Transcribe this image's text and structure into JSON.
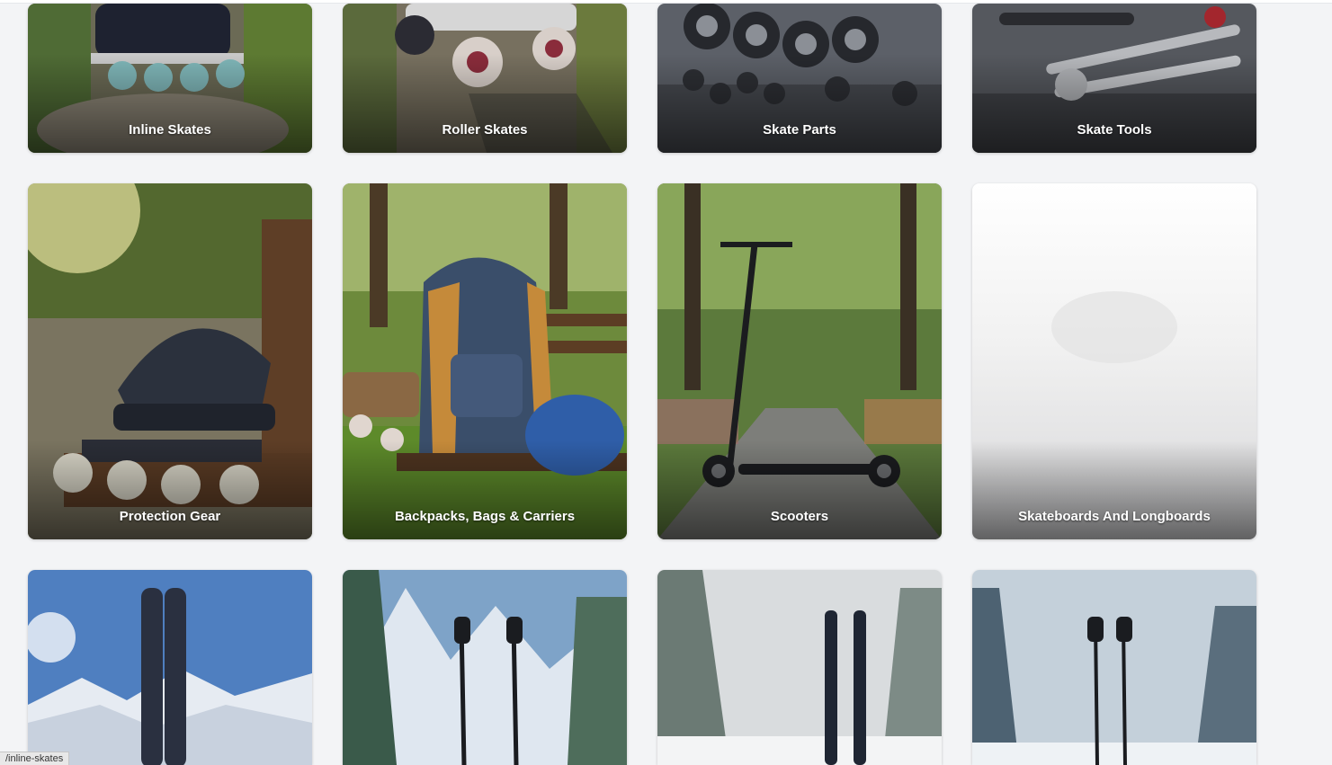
{
  "categories_row1": [
    {
      "label": "Inline Skates",
      "icon": "inline-skates-image"
    },
    {
      "label": "Roller Skates",
      "icon": "roller-skates-image"
    },
    {
      "label": "Skate Parts",
      "icon": "skate-parts-image"
    },
    {
      "label": "Skate Tools",
      "icon": "skate-tools-image"
    }
  ],
  "categories_row2": [
    {
      "label": "Protection Gear",
      "icon": "protection-gear-image"
    },
    {
      "label": "Backpacks, Bags & Carriers",
      "icon": "backpack-image"
    },
    {
      "label": "Scooters",
      "icon": "scooter-image"
    },
    {
      "label": "Skateboards And Longboards",
      "icon": "skateboard-placeholder-image"
    }
  ],
  "categories_row3": [
    {
      "icon": "skis-mountain-image"
    },
    {
      "icon": "ski-poles-mountain-image"
    },
    {
      "icon": "skis-forest-image"
    },
    {
      "icon": "ski-poles-forest-image"
    }
  ],
  "status_bar": {
    "url": "/inline-skates"
  }
}
